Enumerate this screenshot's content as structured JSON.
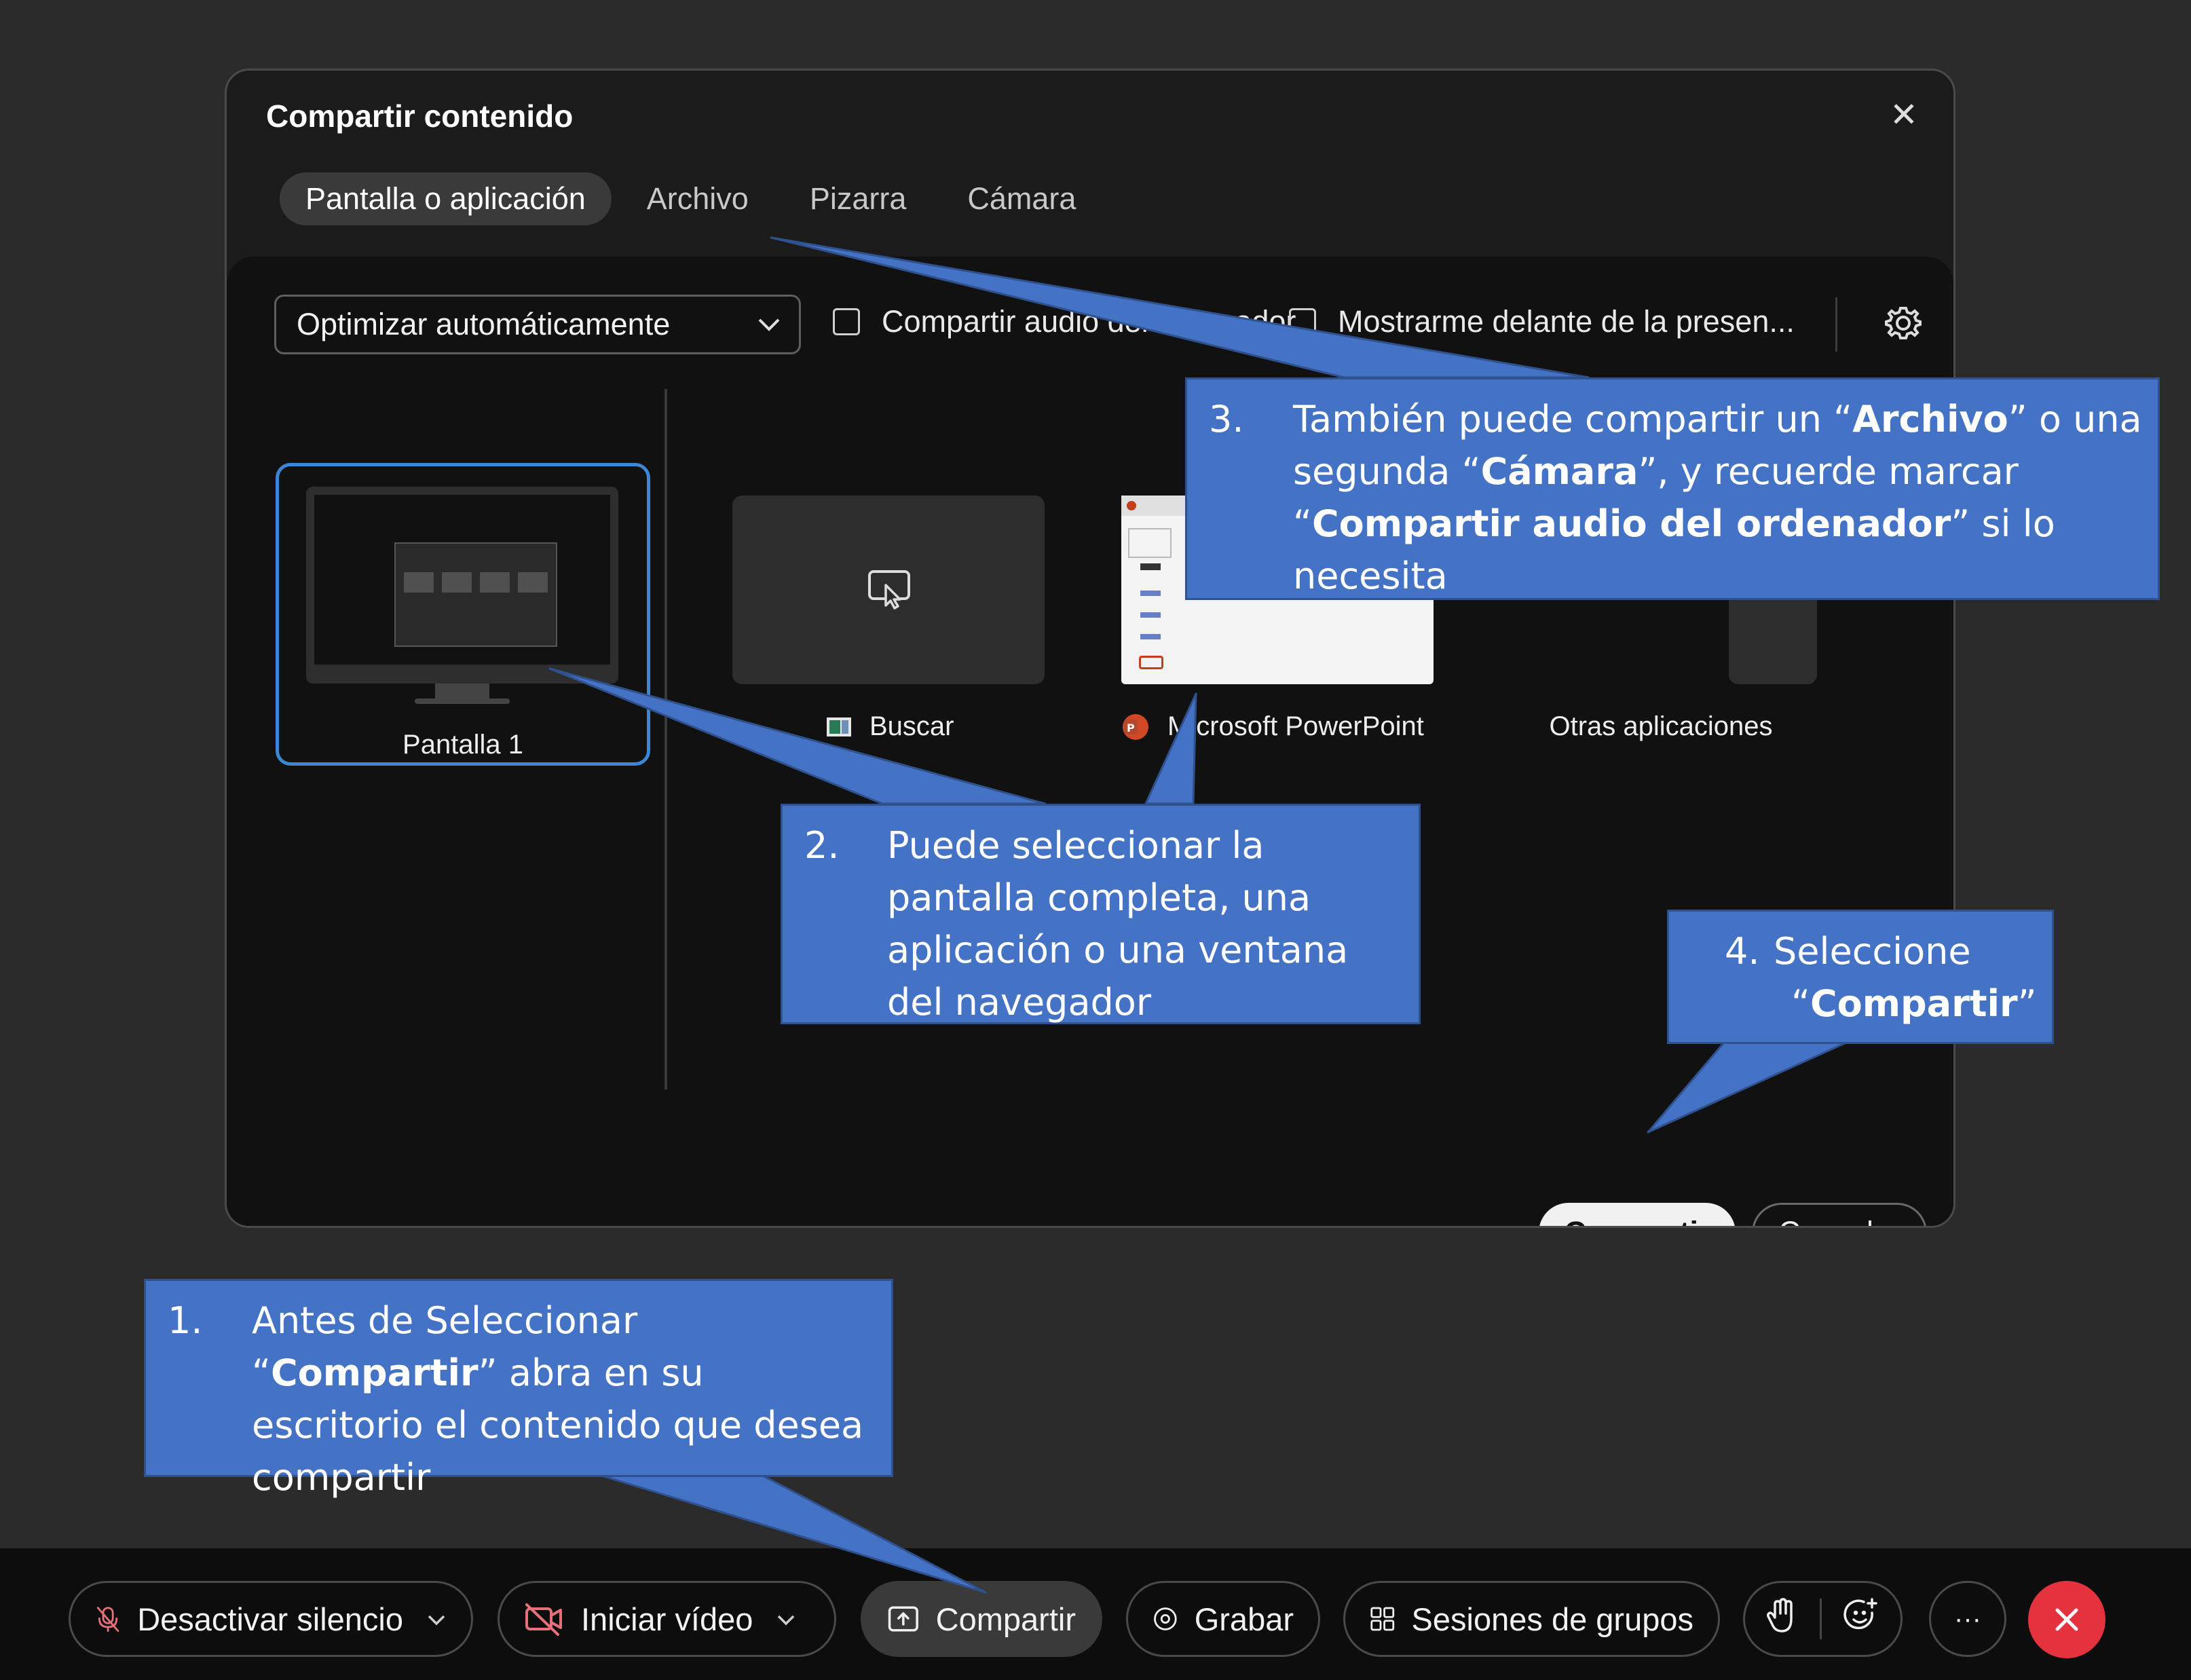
{
  "dialog": {
    "title": "Compartir contenido",
    "close_label": "✕",
    "tabs": [
      {
        "label": "Pantalla o aplicación",
        "active": true
      },
      {
        "label": "Archivo",
        "active": false
      },
      {
        "label": "Pizarra",
        "active": false
      },
      {
        "label": "Cámara",
        "active": false
      }
    ],
    "optimize": {
      "value": "Optimizar automáticamente",
      "icon": "chevron-down-icon"
    },
    "share_audio_label": "Compartir audio del ordenador",
    "show_me_label": "Mostrarme delante de la presen...",
    "settings_icon": "gear-icon",
    "screens": [
      {
        "label": "Pantalla 1",
        "selected": true
      }
    ],
    "apps": [
      {
        "label": "Buscar",
        "icon": "search-app-icon"
      },
      {
        "label": "Microsoft PowerPoint",
        "icon": "powerpoint-icon"
      },
      {
        "label": "Otras aplicaciones",
        "icon": ""
      }
    ],
    "share_button": "Compartir",
    "cancel_button": "Cancelar"
  },
  "toolbar": {
    "mute": "Desactivar silencio",
    "video": "Iniciar vídeo",
    "share": "Compartir",
    "record": "Grabar",
    "breakout": "Sesiones de grupos",
    "more": "···",
    "colors": {
      "end_call": "#e5323f",
      "accent": "#3b87d6"
    }
  },
  "callouts": {
    "c1": {
      "num": "1.",
      "parts": [
        "Antes  de Seleccionar “",
        "Compartir",
        "” abra en su escritorio el contenido que desea compartir"
      ]
    },
    "c2": {
      "num": "2.",
      "text": "Puede seleccionar la pantalla completa, una aplicación o una ventana del navegador"
    },
    "c3": {
      "num": "3.",
      "parts": [
        "También puede compartir un “",
        "Archivo",
        "” o una segunda “",
        "Cámara",
        "”, y recuerde marcar “",
        "Compartir audio del ordenador",
        "” si lo necesita"
      ]
    },
    "c4": {
      "num": "4.",
      "parts": [
        "Seleccione “",
        "Compartir",
        "”"
      ]
    },
    "color": "#4472c4"
  }
}
